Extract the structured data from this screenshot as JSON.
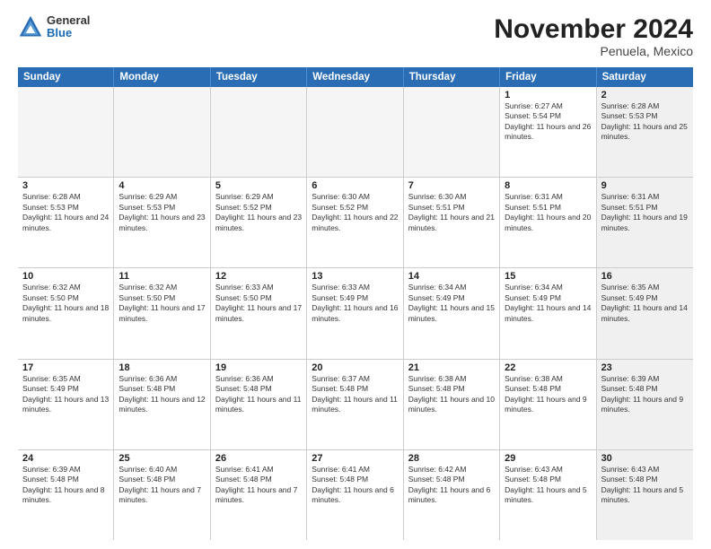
{
  "header": {
    "title": "November 2024",
    "subtitle": "Penuela, Mexico",
    "logo_general": "General",
    "logo_blue": "Blue"
  },
  "calendar": {
    "weekdays": [
      "Sunday",
      "Monday",
      "Tuesday",
      "Wednesday",
      "Thursday",
      "Friday",
      "Saturday"
    ],
    "rows": [
      [
        {
          "day": "",
          "info": "",
          "empty": true
        },
        {
          "day": "",
          "info": "",
          "empty": true
        },
        {
          "day": "",
          "info": "",
          "empty": true
        },
        {
          "day": "",
          "info": "",
          "empty": true
        },
        {
          "day": "",
          "info": "",
          "empty": true
        },
        {
          "day": "1",
          "info": "Sunrise: 6:27 AM\nSunset: 5:54 PM\nDaylight: 11 hours and 26 minutes.",
          "shaded": false
        },
        {
          "day": "2",
          "info": "Sunrise: 6:28 AM\nSunset: 5:53 PM\nDaylight: 11 hours and 25 minutes.",
          "shaded": true
        }
      ],
      [
        {
          "day": "3",
          "info": "Sunrise: 6:28 AM\nSunset: 5:53 PM\nDaylight: 11 hours and 24 minutes.",
          "shaded": false
        },
        {
          "day": "4",
          "info": "Sunrise: 6:29 AM\nSunset: 5:53 PM\nDaylight: 11 hours and 23 minutes.",
          "shaded": false
        },
        {
          "day": "5",
          "info": "Sunrise: 6:29 AM\nSunset: 5:52 PM\nDaylight: 11 hours and 23 minutes.",
          "shaded": false
        },
        {
          "day": "6",
          "info": "Sunrise: 6:30 AM\nSunset: 5:52 PM\nDaylight: 11 hours and 22 minutes.",
          "shaded": false
        },
        {
          "day": "7",
          "info": "Sunrise: 6:30 AM\nSunset: 5:51 PM\nDaylight: 11 hours and 21 minutes.",
          "shaded": false
        },
        {
          "day": "8",
          "info": "Sunrise: 6:31 AM\nSunset: 5:51 PM\nDaylight: 11 hours and 20 minutes.",
          "shaded": false
        },
        {
          "day": "9",
          "info": "Sunrise: 6:31 AM\nSunset: 5:51 PM\nDaylight: 11 hours and 19 minutes.",
          "shaded": true
        }
      ],
      [
        {
          "day": "10",
          "info": "Sunrise: 6:32 AM\nSunset: 5:50 PM\nDaylight: 11 hours and 18 minutes.",
          "shaded": false
        },
        {
          "day": "11",
          "info": "Sunrise: 6:32 AM\nSunset: 5:50 PM\nDaylight: 11 hours and 17 minutes.",
          "shaded": false
        },
        {
          "day": "12",
          "info": "Sunrise: 6:33 AM\nSunset: 5:50 PM\nDaylight: 11 hours and 17 minutes.",
          "shaded": false
        },
        {
          "day": "13",
          "info": "Sunrise: 6:33 AM\nSunset: 5:49 PM\nDaylight: 11 hours and 16 minutes.",
          "shaded": false
        },
        {
          "day": "14",
          "info": "Sunrise: 6:34 AM\nSunset: 5:49 PM\nDaylight: 11 hours and 15 minutes.",
          "shaded": false
        },
        {
          "day": "15",
          "info": "Sunrise: 6:34 AM\nSunset: 5:49 PM\nDaylight: 11 hours and 14 minutes.",
          "shaded": false
        },
        {
          "day": "16",
          "info": "Sunrise: 6:35 AM\nSunset: 5:49 PM\nDaylight: 11 hours and 14 minutes.",
          "shaded": true
        }
      ],
      [
        {
          "day": "17",
          "info": "Sunrise: 6:35 AM\nSunset: 5:49 PM\nDaylight: 11 hours and 13 minutes.",
          "shaded": false
        },
        {
          "day": "18",
          "info": "Sunrise: 6:36 AM\nSunset: 5:48 PM\nDaylight: 11 hours and 12 minutes.",
          "shaded": false
        },
        {
          "day": "19",
          "info": "Sunrise: 6:36 AM\nSunset: 5:48 PM\nDaylight: 11 hours and 11 minutes.",
          "shaded": false
        },
        {
          "day": "20",
          "info": "Sunrise: 6:37 AM\nSunset: 5:48 PM\nDaylight: 11 hours and 11 minutes.",
          "shaded": false
        },
        {
          "day": "21",
          "info": "Sunrise: 6:38 AM\nSunset: 5:48 PM\nDaylight: 11 hours and 10 minutes.",
          "shaded": false
        },
        {
          "day": "22",
          "info": "Sunrise: 6:38 AM\nSunset: 5:48 PM\nDaylight: 11 hours and 9 minutes.",
          "shaded": false
        },
        {
          "day": "23",
          "info": "Sunrise: 6:39 AM\nSunset: 5:48 PM\nDaylight: 11 hours and 9 minutes.",
          "shaded": true
        }
      ],
      [
        {
          "day": "24",
          "info": "Sunrise: 6:39 AM\nSunset: 5:48 PM\nDaylight: 11 hours and 8 minutes.",
          "shaded": false
        },
        {
          "day": "25",
          "info": "Sunrise: 6:40 AM\nSunset: 5:48 PM\nDaylight: 11 hours and 7 minutes.",
          "shaded": false
        },
        {
          "day": "26",
          "info": "Sunrise: 6:41 AM\nSunset: 5:48 PM\nDaylight: 11 hours and 7 minutes.",
          "shaded": false
        },
        {
          "day": "27",
          "info": "Sunrise: 6:41 AM\nSunset: 5:48 PM\nDaylight: 11 hours and 6 minutes.",
          "shaded": false
        },
        {
          "day": "28",
          "info": "Sunrise: 6:42 AM\nSunset: 5:48 PM\nDaylight: 11 hours and 6 minutes.",
          "shaded": false
        },
        {
          "day": "29",
          "info": "Sunrise: 6:43 AM\nSunset: 5:48 PM\nDaylight: 11 hours and 5 minutes.",
          "shaded": false
        },
        {
          "day": "30",
          "info": "Sunrise: 6:43 AM\nSunset: 5:48 PM\nDaylight: 11 hours and 5 minutes.",
          "shaded": true
        }
      ]
    ]
  }
}
